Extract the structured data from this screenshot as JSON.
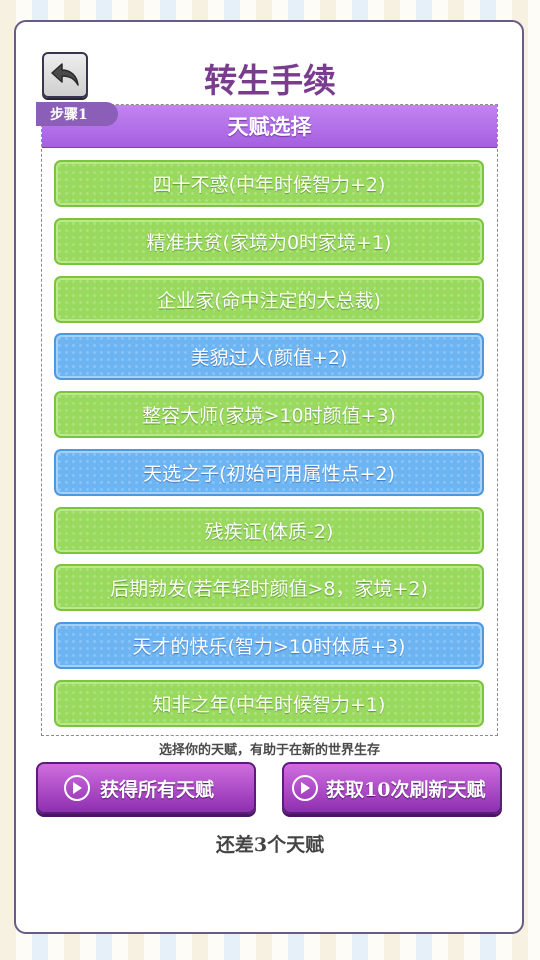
{
  "header": {
    "title": "转生手续",
    "back_icon": "back-arrow-icon"
  },
  "step": {
    "tag": "步骤1",
    "panel_title": "天赋选择"
  },
  "talents": [
    {
      "label": "四十不惑(中年时候智力+2)",
      "color": "green"
    },
    {
      "label": "精准扶贫(家境为0时家境+1)",
      "color": "green"
    },
    {
      "label": "企业家(命中注定的大总裁)",
      "color": "green"
    },
    {
      "label": "美貌过人(颜值+2)",
      "color": "blue"
    },
    {
      "label": "整容大师(家境>10时颜值+3)",
      "color": "green"
    },
    {
      "label": "天选之子(初始可用属性点+2)",
      "color": "blue"
    },
    {
      "label": "残疾证(体质-2)",
      "color": "green"
    },
    {
      "label": "后期勃发(若年轻时颜值>8，家境+2)",
      "color": "green"
    },
    {
      "label": "天才的快乐(智力>10时体质+3)",
      "color": "blue"
    },
    {
      "label": "知非之年(中年时候智力+1)",
      "color": "green"
    }
  ],
  "hint": "选择你的天赋，有助于在新的世界生存",
  "buttons": {
    "get_all": "获得所有天赋",
    "refresh": "获取10次刷新天赋",
    "icon": "play-circle-icon"
  },
  "remaining": "还差3个天赋",
  "colors": {
    "title": "#7a3d8e",
    "green": "#98d95e",
    "blue": "#6db4f3",
    "purple": "#a65fe0"
  }
}
